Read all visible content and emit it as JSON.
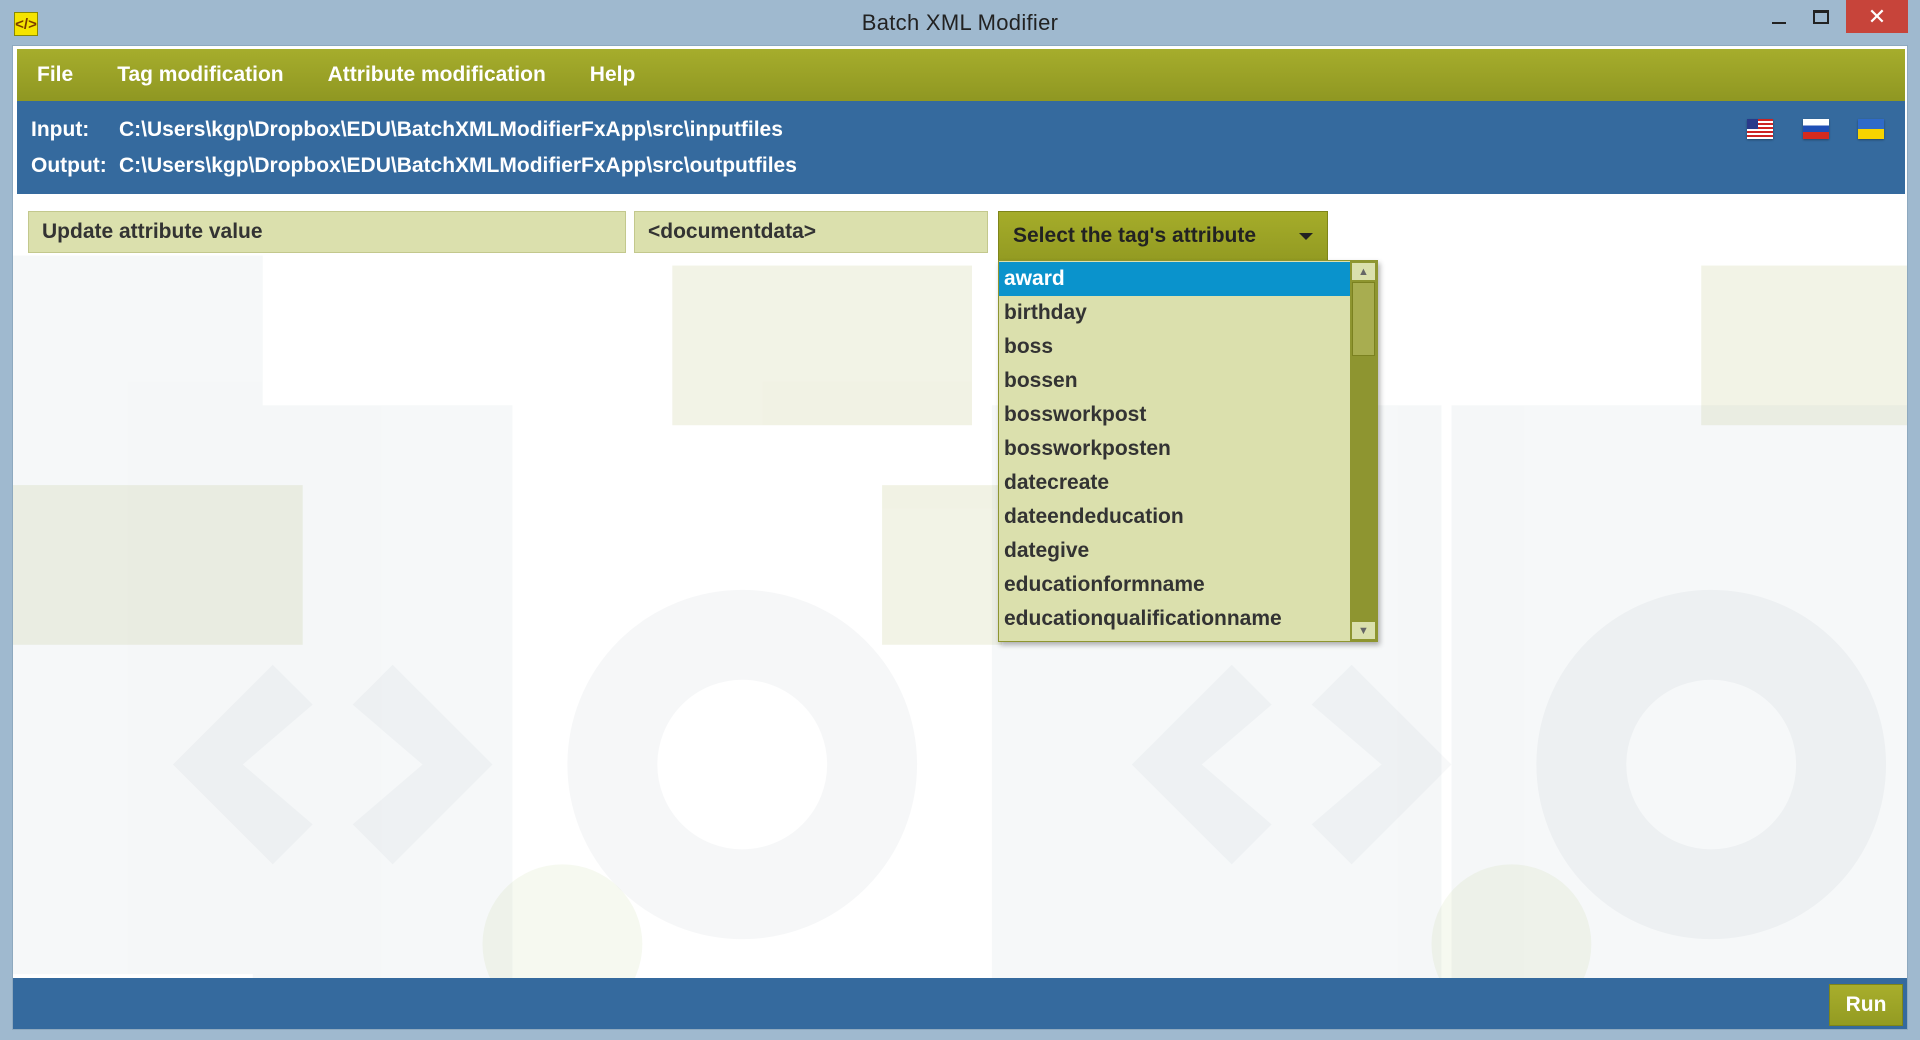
{
  "window": {
    "title": "Batch XML Modifier",
    "close_glyph": "✕"
  },
  "menu": {
    "items": [
      "File",
      "Tag modification",
      "Attribute modification",
      "Help"
    ]
  },
  "paths": {
    "input_label": "Input:",
    "input_value": "C:\\Users\\kgp\\Dropbox\\EDU\\BatchXMLModifierFxApp\\src\\inputfiles",
    "output_label": "Output:",
    "output_value": "C:\\Users\\kgp\\Dropbox\\EDU\\BatchXMLModifierFxApp\\src\\outputfiles"
  },
  "languages": [
    "us-flag-icon",
    "ru-flag-icon",
    "ua-flag-icon"
  ],
  "controls": {
    "operation": "Update attribute value",
    "tag": "<documentdata>",
    "attribute_select_prompt": "Select the tag's attribute"
  },
  "dropdown": {
    "selected_index": 0,
    "items": [
      "award",
      "birthday",
      "boss",
      "bossen",
      "bossworkpost",
      "bossworkposten",
      "datecreate",
      "dateendeducation",
      "dategive",
      "educationformname",
      "educationqualificationname"
    ]
  },
  "footer": {
    "run_label": "Run"
  },
  "colors": {
    "olive_accent": "#9ca327",
    "blue_bar": "#356a9e",
    "field_bg": "#dbe0ad",
    "selected_item": "#0a93cc",
    "close_button": "#c7443a"
  }
}
